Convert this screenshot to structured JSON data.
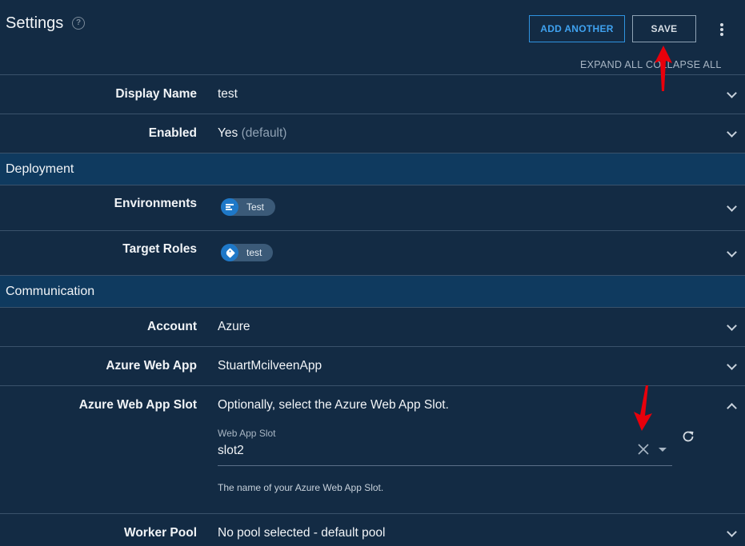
{
  "header": {
    "title": "Settings",
    "help_icon": "question-circle-icon",
    "add_another_label": "ADD ANOTHER",
    "save_label": "SAVE",
    "more_icon": "more-vertical-icon",
    "expand_all_label": "EXPAND ALL",
    "collapse_all_label": "COLLAPSE ALL"
  },
  "fields": {
    "display_name": {
      "label": "Display Name",
      "value": "test"
    },
    "enabled": {
      "label": "Enabled",
      "value": "Yes",
      "hint": "(default)"
    },
    "environments": {
      "label": "Environments",
      "chip": "Test",
      "chip_icon": "environment-icon"
    },
    "target_roles": {
      "label": "Target Roles",
      "chip": "test",
      "chip_icon": "tag-icon"
    },
    "account": {
      "label": "Account",
      "value": "Azure"
    },
    "web_app": {
      "label": "Azure Web App",
      "value": "StuartMcilveenApp"
    },
    "web_app_slot": {
      "label": "Azure Web App Slot",
      "description": "Optionally, select the Azure Web App Slot.",
      "field_label": "Web App Slot",
      "field_value": "slot2",
      "help_text": "The name of your Azure Web App Slot."
    },
    "worker_pool": {
      "label": "Worker Pool",
      "value": "No pool selected - default pool"
    }
  },
  "sections": {
    "deployment": "Deployment",
    "communication": "Communication"
  },
  "colors": {
    "background": "#132b44",
    "section_background": "#0f3a5f",
    "accent": "#3fa2f0",
    "annotation_arrow": "#e8000b"
  }
}
